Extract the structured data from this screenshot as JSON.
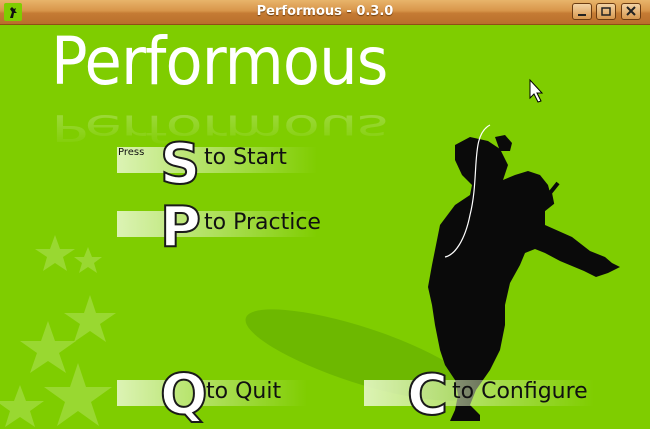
{
  "window": {
    "title": "Performous - 0.3.0"
  },
  "logo": {
    "text": "Performous"
  },
  "menu": {
    "press_label": "Press",
    "start": {
      "key": "S",
      "label": "to Start"
    },
    "practice": {
      "key": "P",
      "label": "to Practice"
    },
    "quit": {
      "key": "Q",
      "label": "to Quit"
    },
    "configure": {
      "key": "C",
      "label": "to Configure"
    }
  },
  "colors": {
    "background": "#7fcd00",
    "titlebar": "#d8954a",
    "silhouette": "#0a0a0a"
  }
}
